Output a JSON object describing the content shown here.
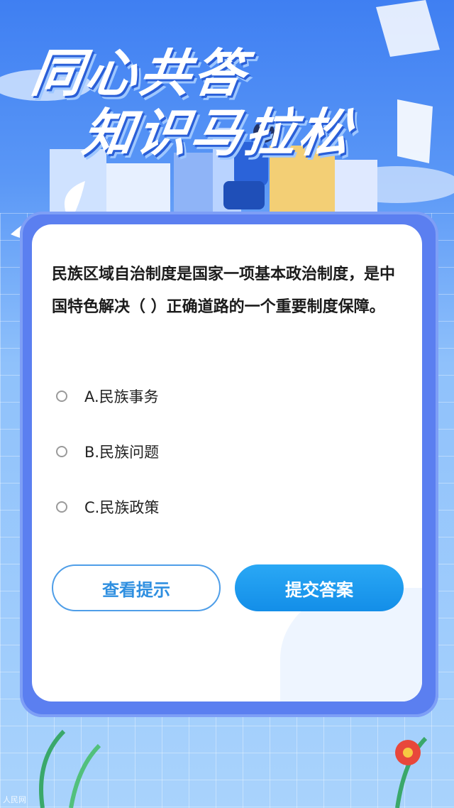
{
  "banner": {
    "title_line1": "同心共答",
    "title_line2": "知识马拉松"
  },
  "question": {
    "text": "民族区域自治制度是国家一项基本政治制度，是中国特色解决（ ）正确道路的一个重要制度保障。"
  },
  "options": [
    {
      "label": "A.民族事务"
    },
    {
      "label": "B.民族问题"
    },
    {
      "label": "C.民族政策"
    }
  ],
  "buttons": {
    "hint": "查看提示",
    "submit": "提交答案"
  },
  "watermark": "人民网"
}
